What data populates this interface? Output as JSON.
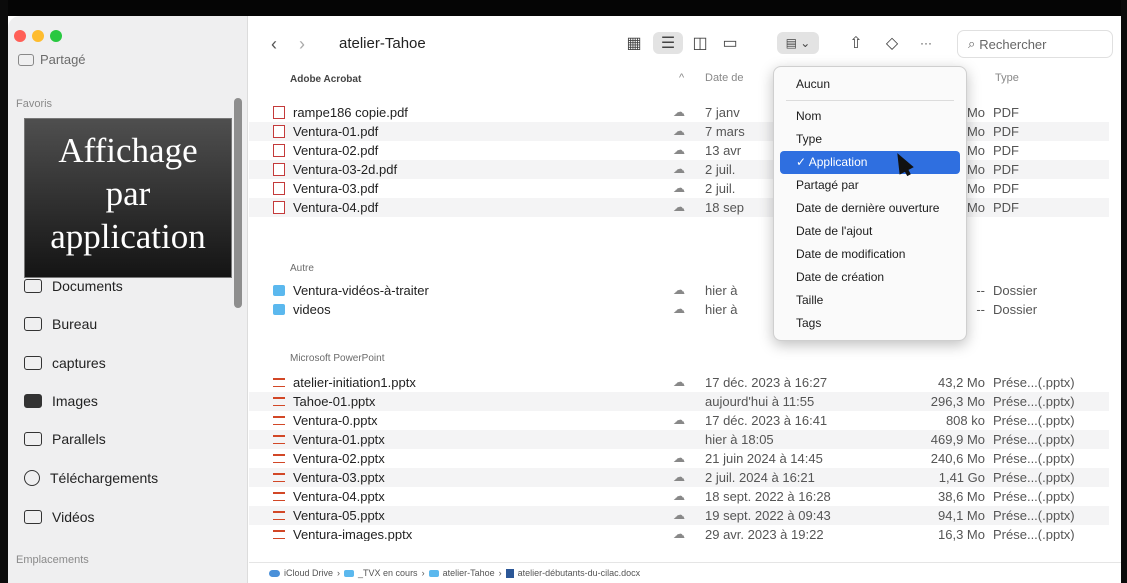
{
  "window": {
    "title": "atelier-Tahoe"
  },
  "sidebar": {
    "shared_label": "Partagé",
    "favorites_title": "Favoris",
    "items": [
      {
        "label": "Documents",
        "icon": "document-icon"
      },
      {
        "label": "Bureau",
        "icon": "desktop-icon"
      },
      {
        "label": "captures",
        "icon": "folder-icon"
      },
      {
        "label": "Images",
        "icon": "photo-icon"
      },
      {
        "label": "Parallels",
        "icon": "folder-icon"
      },
      {
        "label": "Téléchargements",
        "icon": "download-icon"
      },
      {
        "label": "Vidéos",
        "icon": "film-icon"
      }
    ],
    "locations_title": "Emplacements"
  },
  "overlay": {
    "line1": "Affichage",
    "line2": "par",
    "line3": "application"
  },
  "toolbar": {
    "back_glyph": "‹",
    "forward_glyph": "›",
    "more_glyph": "···",
    "search_placeholder": "Rechercher"
  },
  "columns": {
    "date": "Date de",
    "type": "Type"
  },
  "groups": {
    "acrobat": {
      "label": "Adobe Acrobat",
      "rows": [
        {
          "name": "rampe186 copie.pdf",
          "date": "7 janv",
          "size": "Mo",
          "kind": "PDF"
        },
        {
          "name": "Ventura-01.pdf",
          "date": "7 mars",
          "size": "Mo",
          "kind": "PDF"
        },
        {
          "name": "Ventura-02.pdf",
          "date": "13 avr",
          "size": "Mo",
          "kind": "PDF"
        },
        {
          "name": "Ventura-03-2d.pdf",
          "date": "2 juil.",
          "size": "Mo",
          "kind": "PDF"
        },
        {
          "name": "Ventura-03.pdf",
          "date": "2 juil.",
          "size": "Mo",
          "kind": "PDF"
        },
        {
          "name": "Ventura-04.pdf",
          "date": "18 sep",
          "size": "Mo",
          "kind": "PDF"
        }
      ]
    },
    "other": {
      "label": "Autre",
      "rows": [
        {
          "name": "Ventura-vidéos-à-traiter",
          "date": "hier à",
          "size": "--",
          "kind": "Dossier"
        },
        {
          "name": "videos",
          "date": "hier à",
          "size": "--",
          "kind": "Dossier"
        }
      ]
    },
    "powerpoint": {
      "label": "Microsoft PowerPoint",
      "rows": [
        {
          "name": "atelier-initiation1.pptx",
          "date": "17 déc. 2023 à 16:27",
          "size": "43,2 Mo",
          "kind": "Prése...(.pptx)"
        },
        {
          "name": "Tahoe-01.pptx",
          "date": "aujourd'hui à 11:55",
          "size": "296,3 Mo",
          "kind": "Prése...(.pptx)"
        },
        {
          "name": "Ventura-0.pptx",
          "date": "17 déc. 2023 à 16:41",
          "size": "808 ko",
          "kind": "Prése...(.pptx)"
        },
        {
          "name": "Ventura-01.pptx",
          "date": "hier à 18:05",
          "size": "469,9 Mo",
          "kind": "Prése...(.pptx)"
        },
        {
          "name": "Ventura-02.pptx",
          "date": "21 juin 2024 à 14:45",
          "size": "240,6 Mo",
          "kind": "Prése...(.pptx)"
        },
        {
          "name": "Ventura-03.pptx",
          "date": "2 juil. 2024 à 16:21",
          "size": "1,41 Go",
          "kind": "Prése...(.pptx)"
        },
        {
          "name": "Ventura-04.pptx",
          "date": "18 sept. 2022 à 16:28",
          "size": "38,6 Mo",
          "kind": "Prése...(.pptx)"
        },
        {
          "name": "Ventura-05.pptx",
          "date": "19 sept. 2022 à 09:43",
          "size": "94,1 Mo",
          "kind": "Prése...(.pptx)"
        },
        {
          "name": "Ventura-images.pptx",
          "date": "29 avr. 2023 à 19:22",
          "size": "16,3 Mo",
          "kind": "Prése...(.pptx)"
        }
      ]
    }
  },
  "pathbar": {
    "items": [
      "iCloud Drive",
      "_TVX en cours",
      "atelier-Tahoe",
      "atelier-débutants-du-cilac.docx"
    ]
  },
  "group_menu": {
    "items": [
      "Aucun",
      "Nom",
      "Type",
      "Application",
      "Partagé par",
      "Date de dernière ouverture",
      "Date de l'ajout",
      "Date de modification",
      "Date de création",
      "Taille",
      "Tags"
    ],
    "selected": "Application",
    "check": "✓"
  },
  "colors": {
    "accent": "#2f6fe0",
    "folder": "#5bb8ee",
    "pdf": "#c43a3a",
    "ppt": "#d24726"
  }
}
